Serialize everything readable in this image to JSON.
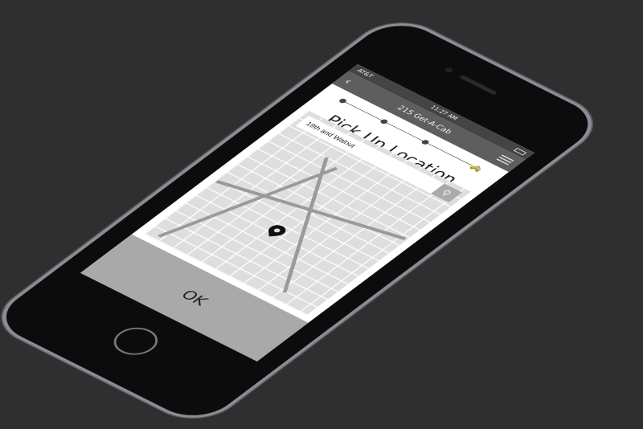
{
  "status": {
    "carrier": "AT&T",
    "time": "11:27 AM"
  },
  "nav": {
    "back_icon": "‹",
    "title": "215 Get-A-Cab"
  },
  "progress": {
    "steps": 4,
    "current": 1
  },
  "page_title": "Pick Up Location",
  "search": {
    "value": "19th and Walnut",
    "icon": "⚲"
  },
  "ok_label": "OK"
}
